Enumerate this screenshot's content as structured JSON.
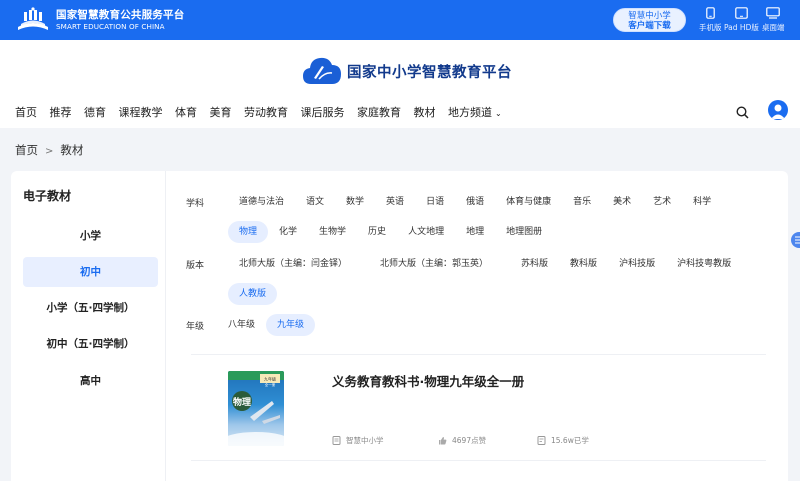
{
  "topbar": {
    "logo_cn": "国家智慧教育公共服务平台",
    "logo_en": "SMART EDUCATION OF CHINA",
    "download_line1": "智慧中小学",
    "download_line2": "客户端下载",
    "devices": [
      {
        "label": "手机版",
        "icon": "phone-icon"
      },
      {
        "label": "Pad HD版",
        "icon": "tablet-icon"
      },
      {
        "label": "桌面端",
        "icon": "desktop-icon"
      }
    ]
  },
  "header": {
    "brand_title": "国家中小学智慧教育平台",
    "nav": [
      "首页",
      "推荐",
      "德育",
      "课程教学",
      "体育",
      "美育",
      "劳动教育",
      "课后服务",
      "家庭教育",
      "教材",
      "地方频道"
    ],
    "accent": "#1a6cf0"
  },
  "breadcrumb": [
    "首页",
    "教材"
  ],
  "sidebar": {
    "title": "电子教材",
    "items": [
      "小学",
      "初中",
      "小学（五·四学制）",
      "初中（五·四学制）",
      "高中"
    ],
    "active_index": 1
  },
  "filters": {
    "subject_label": "学科",
    "subjects": [
      "道德与法治",
      "语文",
      "数学",
      "英语",
      "日语",
      "俄语",
      "体育与健康",
      "音乐",
      "美术",
      "艺术",
      "科学",
      "物理",
      "化学",
      "生物学",
      "历史",
      "人文地理",
      "地理",
      "地理图册"
    ],
    "subject_active": "物理",
    "edition_label": "版本",
    "editions": [
      "北师大版（主编：闫金铎）",
      "北师大版（主编：郭玉英）",
      "苏科版",
      "教科版",
      "沪科技版",
      "沪科技粤教版",
      "人教版"
    ],
    "edition_active": "人教版",
    "grade_label": "年级",
    "grades": [
      "八年级",
      "九年级"
    ],
    "grade_active": "九年级"
  },
  "book": {
    "title": "义务教育教科书·物理九年级全一册",
    "cover_title": "物理",
    "cover_grade": "九年级",
    "cover_volume": "全一册",
    "publisher": "智慧中小学",
    "likes": "4697点赞",
    "learners": "15.6w已学"
  }
}
